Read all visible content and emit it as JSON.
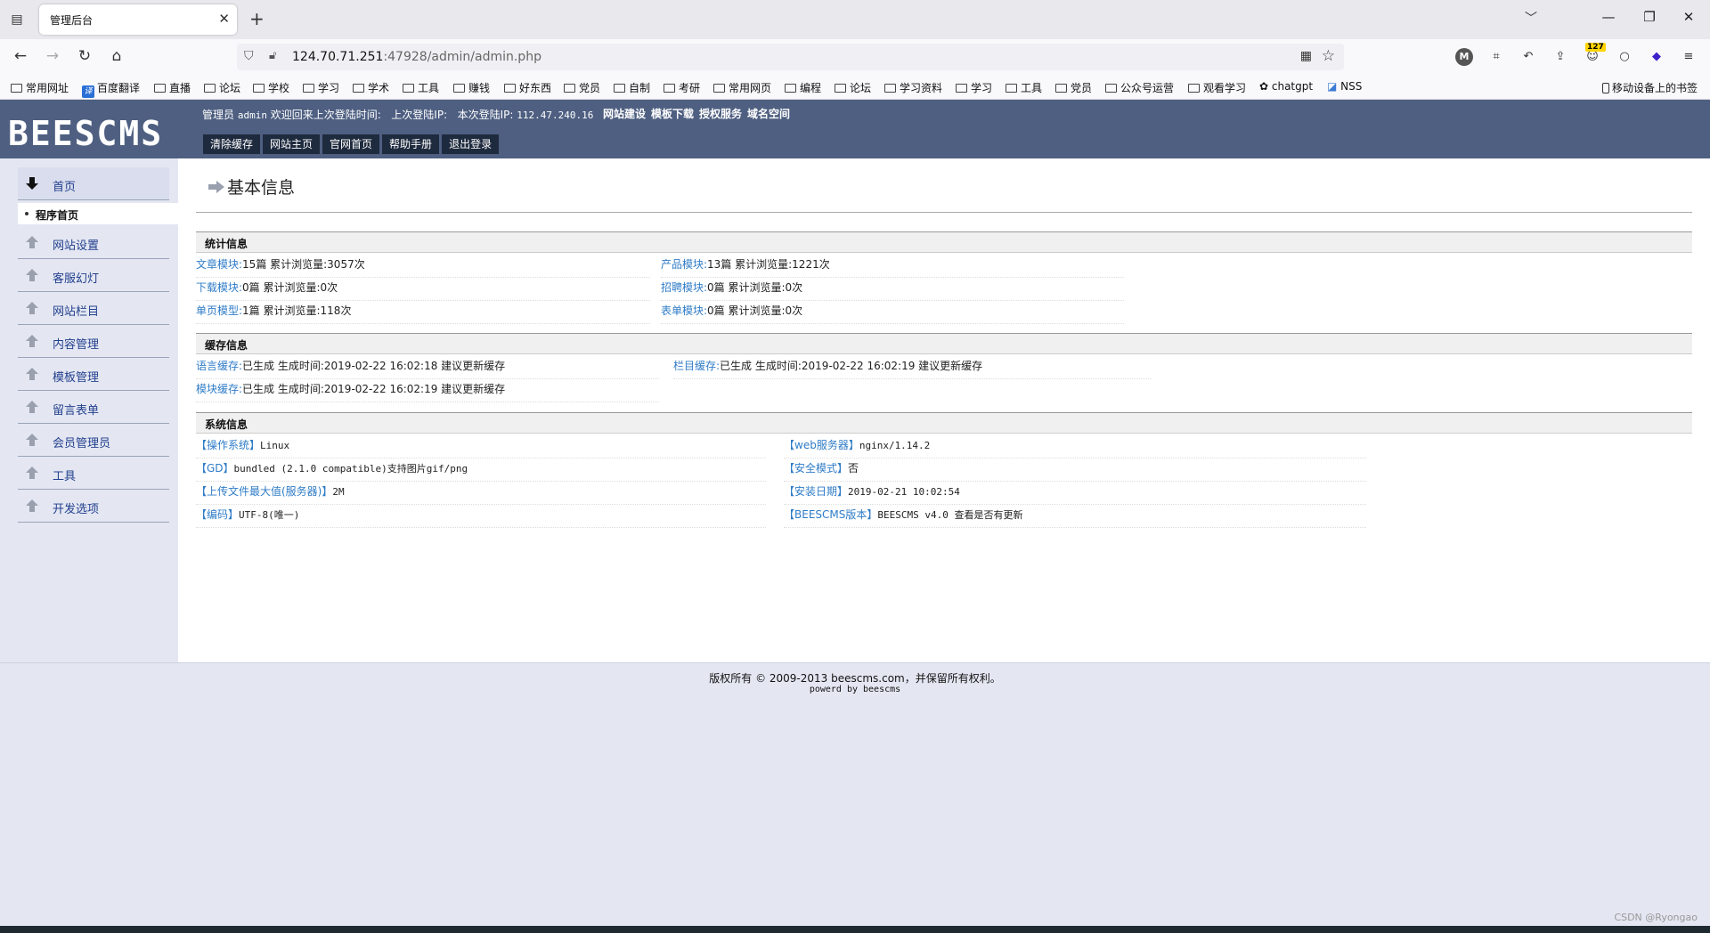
{
  "browser": {
    "tab_title": "管理后台",
    "url_host": "124.70.71.251",
    "url_rest": ":47928/admin/admin.php",
    "extension_badge": "127",
    "bookmarks": [
      "常用网址",
      "百度翻译",
      "直播",
      "论坛",
      "学校",
      "学习",
      "学术",
      "工具",
      "赚钱",
      "好东西",
      "党员",
      "自制",
      "考研",
      "常用网页",
      "编程",
      "论坛",
      "学习资料",
      "学习",
      "工具",
      "党员",
      "公众号运营",
      "观看学习",
      "chatgpt",
      "NSS"
    ],
    "mobile_bookmarks": "移动设备上的书签"
  },
  "header": {
    "logo": "BEESCMS",
    "admin_label": "管理员",
    "admin_name": "admin",
    "welcome": "欢迎回来上次登陆时间:",
    "last_ip_label": "上次登陆IP:",
    "current_ip_label": "本次登陆IP:",
    "current_ip": "112.47.240.16",
    "links": [
      "网站建设",
      "模板下载",
      "授权服务",
      "域名空间"
    ],
    "buttons": [
      "清除缓存",
      "网站主页",
      "官网首页",
      "帮助手册",
      "退出登录"
    ]
  },
  "sidebar": {
    "home": "首页",
    "sub_home": "程序首页",
    "items": [
      "网站设置",
      "客服幻灯",
      "网站栏目",
      "内容管理",
      "模板管理",
      "留言表单",
      "会员管理员",
      "工具",
      "开发选项"
    ]
  },
  "main": {
    "title": "基本信息",
    "stats": {
      "heading": "统计信息",
      "rows": [
        {
          "k": "文章模块:",
          "v": "15篇  累计浏览量:3057次"
        },
        {
          "k": "产品模块:",
          "v": "13篇  累计浏览量:1221次"
        },
        {
          "k": "下载模块:",
          "v": "0篇  累计浏览量:0次"
        },
        {
          "k": "招聘模块:",
          "v": "0篇  累计浏览量:0次"
        },
        {
          "k": "单页模型:",
          "v": "1篇  累计浏览量:118次"
        },
        {
          "k": "表单模块:",
          "v": "0篇  累计浏览量:0次"
        }
      ]
    },
    "cache": {
      "heading": "缓存信息",
      "rows": [
        {
          "k": "语言缓存:",
          "v": "已生成    生成时间:2019-02-22 16:02:18  建议更新缓存"
        },
        {
          "k": "栏目缓存:",
          "v": "已生成    生成时间:2019-02-22 16:02:19  建议更新缓存"
        },
        {
          "k": "模块缓存:",
          "v": "已生成    生成时间:2019-02-22 16:02:19  建议更新缓存"
        }
      ]
    },
    "system": {
      "heading": "系统信息",
      "rows": [
        {
          "k": "【操作系统】",
          "v": "Linux"
        },
        {
          "k": "【web服务器】",
          "v": "nginx/1.14.2"
        },
        {
          "k": "【GD】",
          "v": "bundled (2.1.0 compatible)支持图片gif/png"
        },
        {
          "k": "【安全模式】",
          "v": "否"
        },
        {
          "k": "【上传文件最大值(服务器)】",
          "v": "2M"
        },
        {
          "k": "【安装日期】",
          "v": "2019-02-21 10:02:54"
        },
        {
          "k": "【编码】",
          "v": "UTF-8(唯一)"
        },
        {
          "k": "【BEESCMS版本】",
          "v": "BEESCMS v4.0  查看是否有更新"
        }
      ]
    }
  },
  "footer": {
    "copyright": "版权所有 © 2009-2013 beescms.com，并保留所有权利。",
    "powered": "powerd by beescms"
  },
  "watermark": "CSDN @Ryongao",
  "colors": {
    "header_bg": "#4e5f81",
    "link": "#2f7cc7",
    "sidebar_bg": "#e4e7f2"
  }
}
